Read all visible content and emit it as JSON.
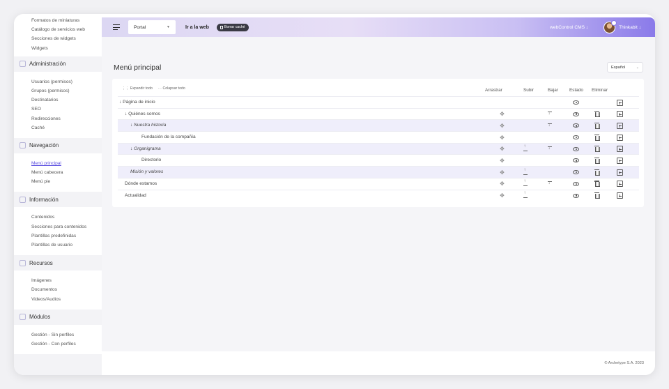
{
  "sidebar": {
    "top_items": [
      "Formatos de miniaturas",
      "Catálogo de servicios web",
      "Secciones de widgets",
      "Widgets"
    ],
    "sections": [
      {
        "title": "Administración",
        "items": [
          "Usuarios (permisos)",
          "Grupos (permisos)",
          "Destinatarios",
          "SEO",
          "Redirecciones",
          "Caché"
        ]
      },
      {
        "title": "Navegación",
        "items": [
          "Menú principal",
          "Menú cabecera",
          "Menú pie"
        ]
      },
      {
        "title": "Información",
        "items": [
          "Contenidos",
          "Secciones para contenidos",
          "Plantillas predefinidas",
          "Plantillas de usuario"
        ]
      },
      {
        "title": "Recursos",
        "items": [
          "Imágenes",
          "Documentos",
          "Videos/Audios"
        ]
      },
      {
        "title": "Módulos",
        "items": [
          "Gestión - Sin perfiles",
          "Gestión - Con perfiles"
        ]
      }
    ],
    "active_item": "Menú principal"
  },
  "topbar": {
    "portal_value": "Portal",
    "goto_web": "Ir a la web",
    "clear_cache": "Borrar caché",
    "cms_menu": "webControl CMS ↓",
    "user_menu": "Thinkabit ↓"
  },
  "main": {
    "title": "Menú principal",
    "language": "Español",
    "expand_all": "Expandir todo",
    "collapse_all": "Colapsar todo",
    "columns": {
      "drag": "Arrastrar",
      "up": "Subir",
      "down": "Bajar",
      "status": "Estado",
      "delete": "Eliminar"
    },
    "rows": [
      {
        "label": "↓ Página de inicio",
        "indent": 0,
        "italic": false,
        "alt": false,
        "drag": false,
        "up": false,
        "down": false,
        "eye": true,
        "trash": false,
        "add": true
      },
      {
        "label": "↓ Quiénes somos",
        "indent": 1,
        "italic": false,
        "alt": false,
        "drag": true,
        "up": false,
        "down": true,
        "eye": true,
        "trash": true,
        "add": true
      },
      {
        "label": "↓ Nuestra historia",
        "indent": 2,
        "italic": true,
        "alt": true,
        "drag": true,
        "up": false,
        "down": true,
        "eye": true,
        "trash": true,
        "add": true
      },
      {
        "label": "Fundación de la compañía",
        "indent": 3,
        "italic": false,
        "alt": false,
        "drag": true,
        "up": false,
        "down": false,
        "eye": true,
        "trash": true,
        "add": true
      },
      {
        "label": "↓ Organigrama",
        "indent": 2,
        "italic": true,
        "alt": true,
        "drag": true,
        "up": true,
        "down": true,
        "eye": true,
        "trash": true,
        "add": true
      },
      {
        "label": "Directorio",
        "indent": 3,
        "italic": false,
        "alt": false,
        "drag": true,
        "up": false,
        "down": false,
        "eye": true,
        "trash": true,
        "add": true
      },
      {
        "label": "Misión y valores",
        "indent": 2,
        "italic": true,
        "alt": true,
        "drag": true,
        "up": true,
        "down": false,
        "eye": true,
        "trash": true,
        "add": true
      },
      {
        "label": "Dónde estamos",
        "indent": 1,
        "italic": false,
        "alt": false,
        "drag": true,
        "up": true,
        "down": true,
        "eye": true,
        "trash": true,
        "add": true
      },
      {
        "label": "Actualidad",
        "indent": 1,
        "italic": false,
        "alt": false,
        "drag": true,
        "up": true,
        "down": false,
        "eye": true,
        "trash": true,
        "add": true
      }
    ]
  },
  "footer": {
    "copyright": "© Archetype S.A. 2023"
  },
  "colors": {
    "accent": "#5b4ee0",
    "gradient_end": "#8a7ae9",
    "row_alt": "#efeefb"
  }
}
